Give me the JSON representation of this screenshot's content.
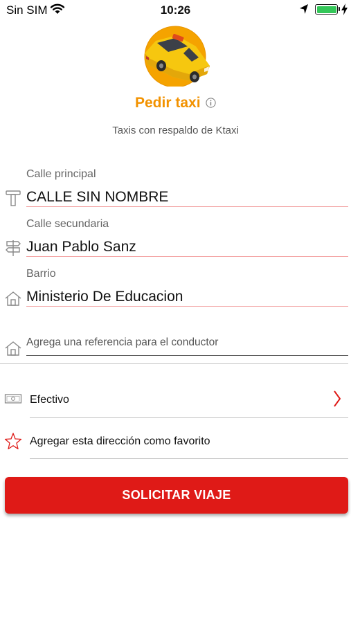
{
  "status_bar": {
    "carrier": "Sin SIM",
    "time": "10:26",
    "battery_level": 1.0
  },
  "header": {
    "logo_icon": "taxi-car-icon",
    "title": "Pedir taxi",
    "subtitle": "Taxis con respaldo de Ktaxi"
  },
  "form": {
    "main_street": {
      "label": "Calle principal",
      "value": "CALLE SIN NOMBRE",
      "icon": "street-sign-icon"
    },
    "secondary_street": {
      "label": "Calle secundaria",
      "value": "Juan Pablo Sanz",
      "icon": "signpost-icon"
    },
    "neighborhood": {
      "label": "Barrio",
      "value": "Ministerio De Educacion",
      "icon": "house-icon"
    },
    "reference": {
      "placeholder": "Agrega una referencia para el conductor",
      "value": "",
      "icon": "house-icon"
    }
  },
  "payment": {
    "label": "Efectivo",
    "icon": "cash-icon"
  },
  "favorite": {
    "label": "Agregar esta dirección como favorito",
    "icon": "star-outline-icon"
  },
  "actions": {
    "request_label": "SOLICITAR VIAJE"
  },
  "colors": {
    "accent_orange": "#f29200",
    "primary_red": "#df1a17",
    "underline_red": "#f3a4a4",
    "battery_green": "#34c759"
  }
}
